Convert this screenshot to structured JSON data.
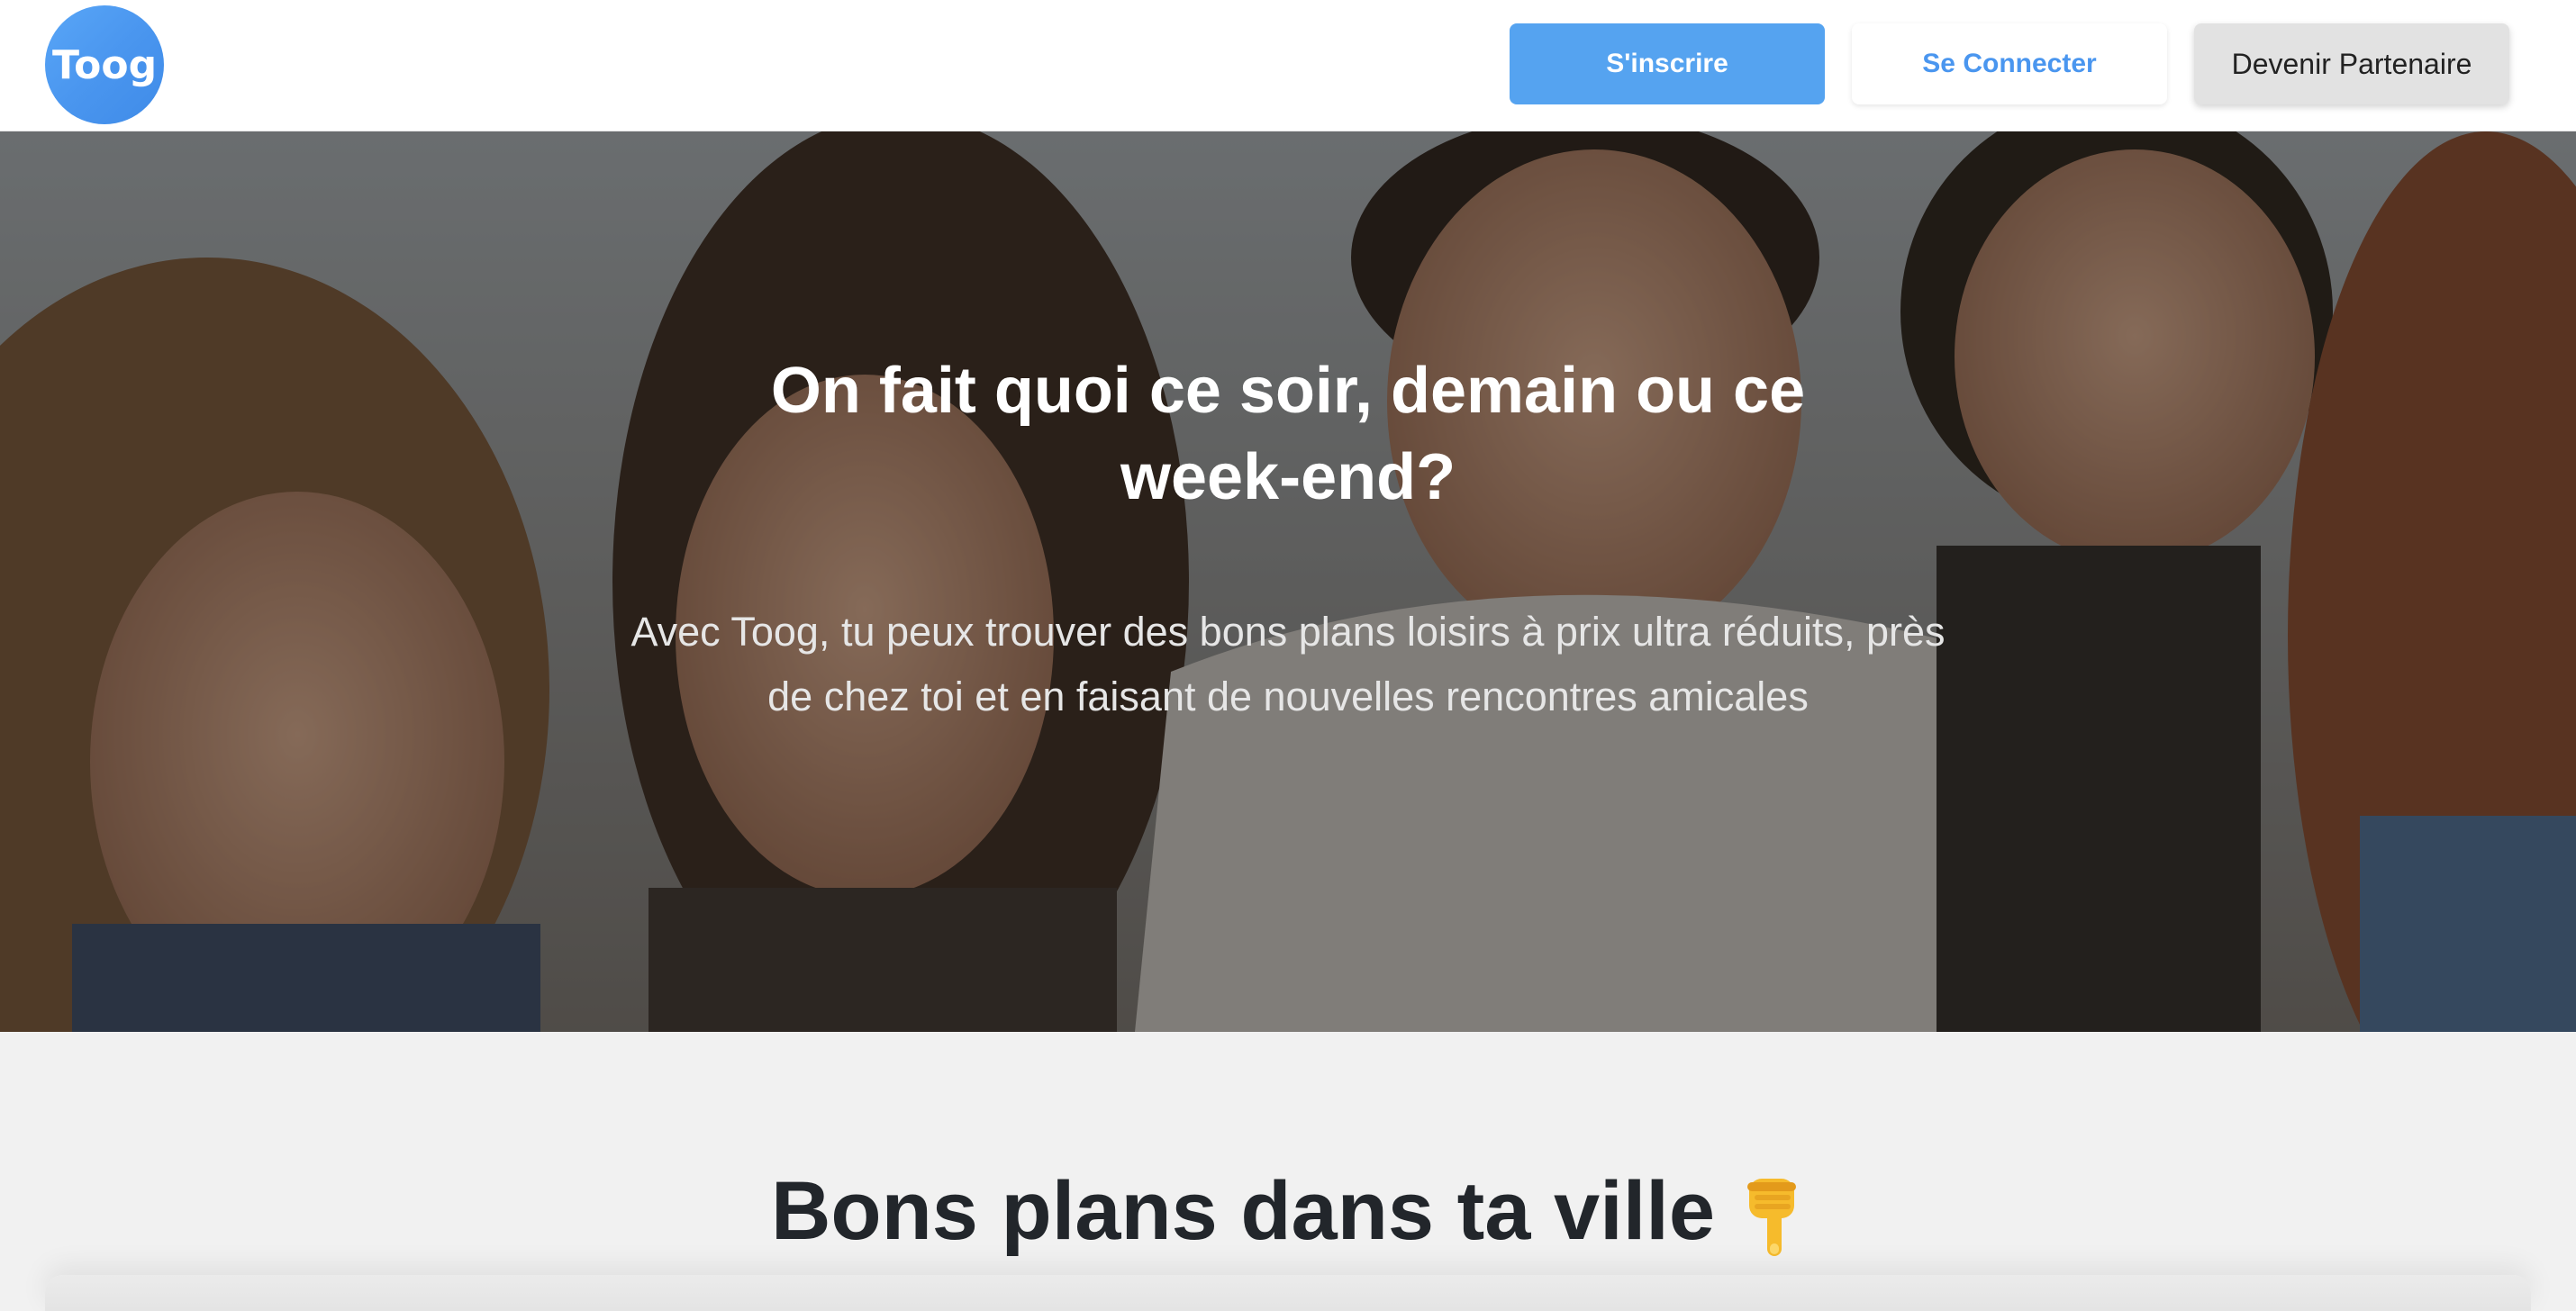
{
  "header": {
    "logo_text": "Toog",
    "signup_label": "S'inscrire",
    "login_label": "Se Connecter",
    "partner_label": "Devenir Partenaire"
  },
  "hero": {
    "title": "On fait quoi ce soir, demain ou ce week-end?",
    "subtitle_line1": "Avec Toog, tu peux trouver des bons plans loisirs à prix ultra réduits, près",
    "subtitle_line2": "de chez toi et en faisant de nouvelles rencontres amicales"
  },
  "section": {
    "title": "Bons plans dans ta ville",
    "title_icon": "pointing-down-hand-icon"
  },
  "colors": {
    "brand_blue": "#55a3f0",
    "link_blue": "#4a96ef",
    "title_dark": "#22262b",
    "section_bg": "#f1f1f1"
  }
}
